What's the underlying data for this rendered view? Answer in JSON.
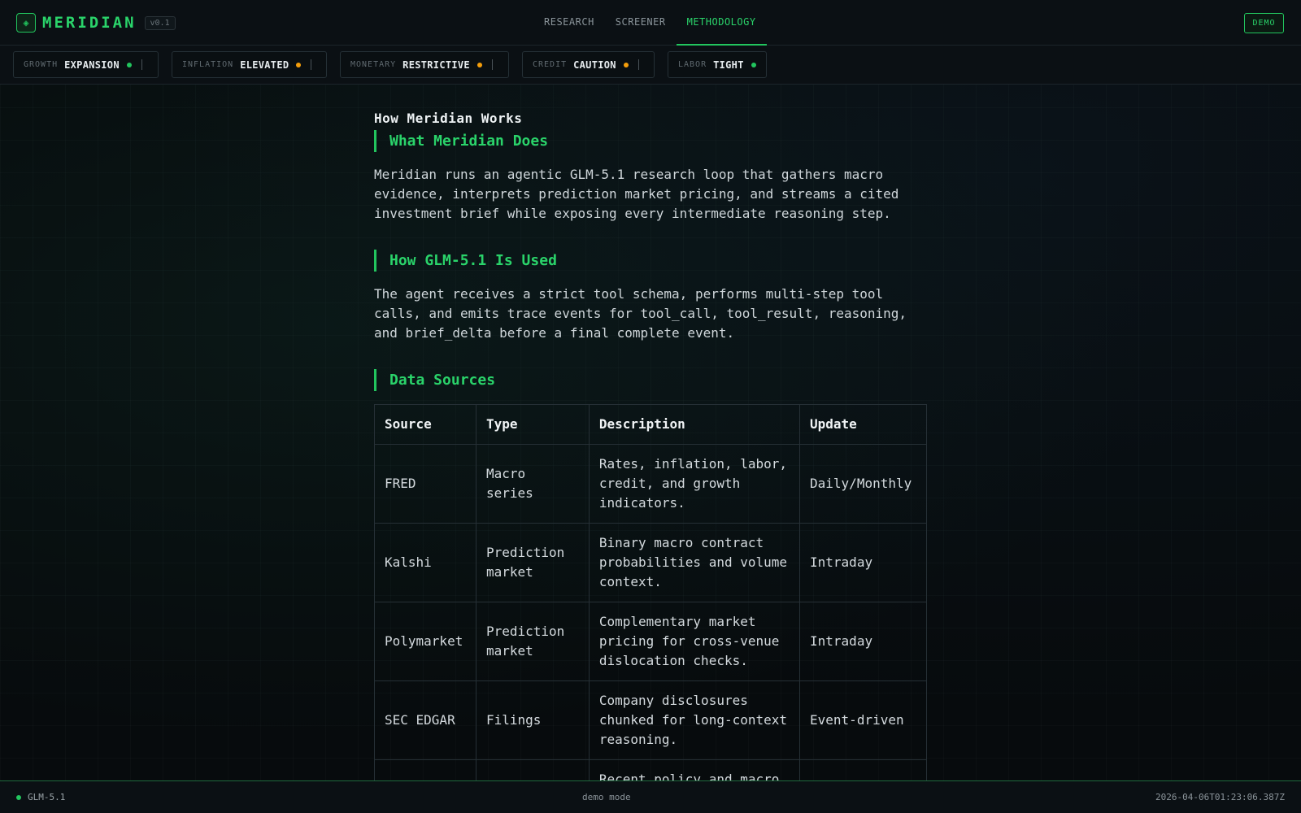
{
  "app": {
    "brand_icon": "◈",
    "name": "MERIDIAN",
    "version": "v0.1",
    "accent_color": "#22c55e"
  },
  "nav": {
    "tabs": [
      {
        "label": "RESEARCH",
        "active": false
      },
      {
        "label": "SCREENER",
        "active": false
      },
      {
        "label": "METHODOLOGY",
        "active": true
      }
    ],
    "demo_label": "DEMO"
  },
  "regime": [
    {
      "label": "GROWTH",
      "value": "EXPANSION",
      "status_color": "#22c55e"
    },
    {
      "label": "INFLATION",
      "value": "ELEVATED",
      "status_color": "#f59e0b"
    },
    {
      "label": "MONETARY",
      "value": "RESTRICTIVE",
      "status_color": "#f59e0b"
    },
    {
      "label": "CREDIT",
      "value": "CAUTION",
      "status_color": "#f59e0b"
    },
    {
      "label": "LABOR",
      "value": "TIGHT",
      "status_color": "#22c55e"
    }
  ],
  "content": {
    "page_title": "How Meridian Works",
    "sections": [
      {
        "heading": "What Meridian Does",
        "body": "Meridian runs an agentic GLM-5.1 research loop that gathers macro evidence, interprets prediction market pricing, and streams a cited investment brief while exposing every intermediate reasoning step."
      },
      {
        "heading": "How GLM-5.1 Is Used",
        "body": "The agent receives a strict tool schema, performs multi-step tool calls, and emits trace events for tool_call, tool_result, reasoning, and brief_delta before a final complete event."
      },
      {
        "heading": "Data Sources"
      }
    ],
    "table": {
      "headers": [
        "Source",
        "Type",
        "Description",
        "Update"
      ],
      "rows": [
        [
          "FRED",
          "Macro series",
          "Rates, inflation, labor, credit, and growth indicators.",
          "Daily/Monthly"
        ],
        [
          "Kalshi",
          "Prediction market",
          "Binary macro contract probabilities and volume context.",
          "Intraday"
        ],
        [
          "Polymarket",
          "Prediction market",
          "Complementary market pricing for cross-venue dislocation checks.",
          "Intraday"
        ],
        [
          "SEC EDGAR",
          "Filings",
          "Company disclosures chunked for long-context reasoning.",
          "Event-driven"
        ],
        [
          "",
          "",
          "Recent policy and macro",
          ""
        ]
      ]
    }
  },
  "footer": {
    "model": "GLM-5.1",
    "mode": "demo mode",
    "timestamp": "2026-04-06T01:23:06.387Z"
  }
}
